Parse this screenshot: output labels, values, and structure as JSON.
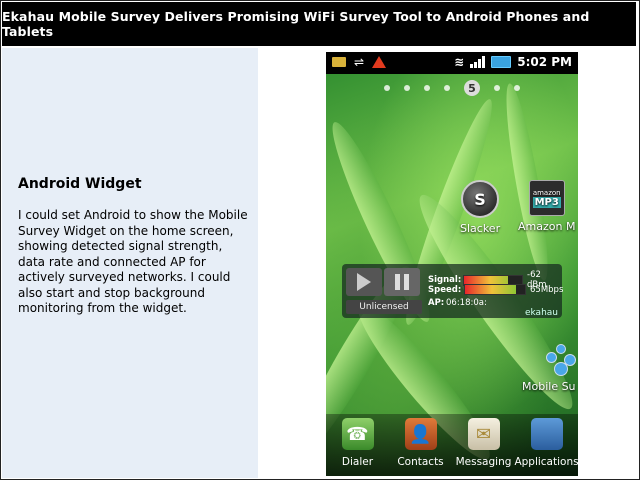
{
  "slide": {
    "title": "Ekahau Mobile Survey Delivers Promising WiFi Survey Tool to Android Phones and Tablets",
    "heading": "Android Widget",
    "body": "I could set Android to show the Mobile Survey Widget on the home screen, showing detected signal strength, data rate and connected AP for actively surveyed networks. I could also start and stop background monitoring from the widget."
  },
  "phone": {
    "status_bar": {
      "time": "5:02 PM",
      "icons": [
        "mail-icon",
        "usb-icon",
        "warning-icon",
        "wifi-icon",
        "signal-bars-icon",
        "battery-icon"
      ]
    },
    "home_page": "5",
    "shortcuts": {
      "slacker": "Slacker",
      "amazon": "Amazon M",
      "amazon_icon_text_top": "amazon",
      "amazon_icon_text_bottom": "MP3",
      "mobile_survey": "Mobile Su"
    },
    "widget": {
      "license": "Unlicensed",
      "signal_label": "Signal:",
      "signal_value": "-62 dBm",
      "signal_level": 0.75,
      "speed_label": "Speed:",
      "speed_value": "65Mbps",
      "speed_level": 0.85,
      "ap_label": "AP:",
      "ap_value": "06:18:0a:",
      "brand": "ekahau"
    },
    "dock": {
      "dialer": "Dialer",
      "contacts": "Contacts",
      "messaging": "Messaging",
      "applications": "Applications"
    }
  },
  "colors": {
    "title_bg": "#000000",
    "panel_bg": "#e7eef7",
    "accent_green": "#6bc832"
  }
}
